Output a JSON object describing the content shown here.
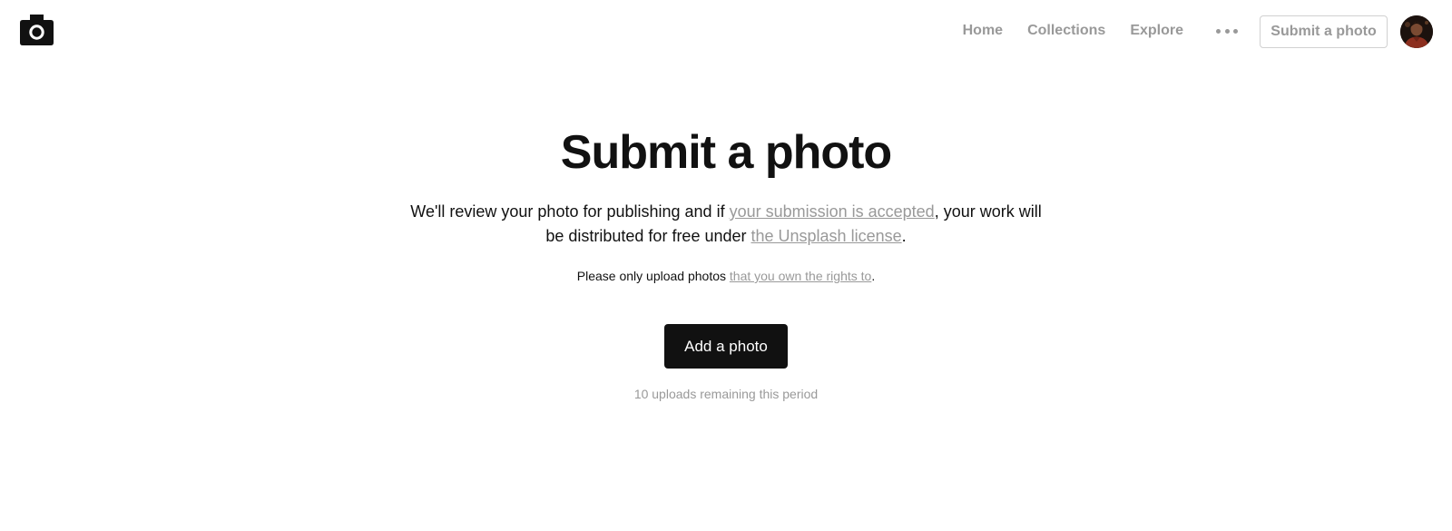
{
  "header": {
    "logo_icon": "camera-icon",
    "nav": [
      {
        "label": "Home"
      },
      {
        "label": "Collections"
      },
      {
        "label": "Explore"
      }
    ],
    "more_icon": "more-dots-icon",
    "submit_label": "Submit a photo",
    "avatar_icon": "user-avatar"
  },
  "main": {
    "title": "Submit a photo",
    "intro_part1": "We'll review your photo for publishing and if ",
    "intro_link1": "your submission is accepted",
    "intro_part2": ", your work will be distributed for free under ",
    "intro_link2": "the Unsplash license",
    "intro_part3": ".",
    "notice_part1": "Please only upload photos ",
    "notice_link": "that you own the rights to",
    "notice_part2": ".",
    "add_button_label": "Add a photo",
    "remaining_text": "10 uploads remaining this period"
  },
  "colors": {
    "text": "#111111",
    "muted": "#999999",
    "button_dark": "#111111",
    "border": "#d1d1d1"
  }
}
